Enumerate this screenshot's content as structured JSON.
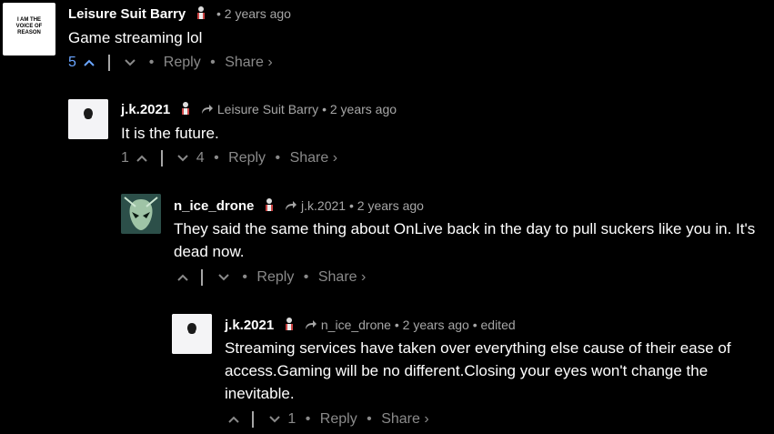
{
  "comments": [
    {
      "author": "Leisure Suit Barry",
      "reply_to": "",
      "time": "2 years ago",
      "edited": "",
      "avatar_text": "I AM THE VOICE OF REASON",
      "text": "Game streaming lol",
      "upvotes": "5",
      "downvotes": "",
      "reply_label": "Reply",
      "share_label": "Share ›"
    },
    {
      "author": "j.k.2021",
      "reply_to": "Leisure Suit Barry",
      "time": "2 years ago",
      "edited": "",
      "text": "It is the future.",
      "upvotes": "1",
      "downvotes": "4",
      "reply_label": "Reply",
      "share_label": "Share ›"
    },
    {
      "author": "n_ice_drone",
      "reply_to": "j.k.2021",
      "time": "2 years ago",
      "edited": "",
      "text": "They said the same thing about OnLive back in the day to pull suckers like you in. It's dead now.",
      "upvotes": "",
      "downvotes": "",
      "reply_label": "Reply",
      "share_label": "Share ›"
    },
    {
      "author": "j.k.2021",
      "reply_to": "n_ice_drone",
      "time": "2 years ago",
      "edited": "edited",
      "text": "Streaming services have taken over everything else cause of their ease of access.Gaming will be no different.Closing your eyes won't change the inevitable.",
      "upvotes": "",
      "downvotes": "1",
      "reply_label": "Reply",
      "share_label": "Share ›"
    }
  ],
  "colors": {
    "background": "#000000",
    "text": "#ffffff",
    "meta": "#a6a6a6",
    "upvote_active": "#6aa5ff"
  }
}
